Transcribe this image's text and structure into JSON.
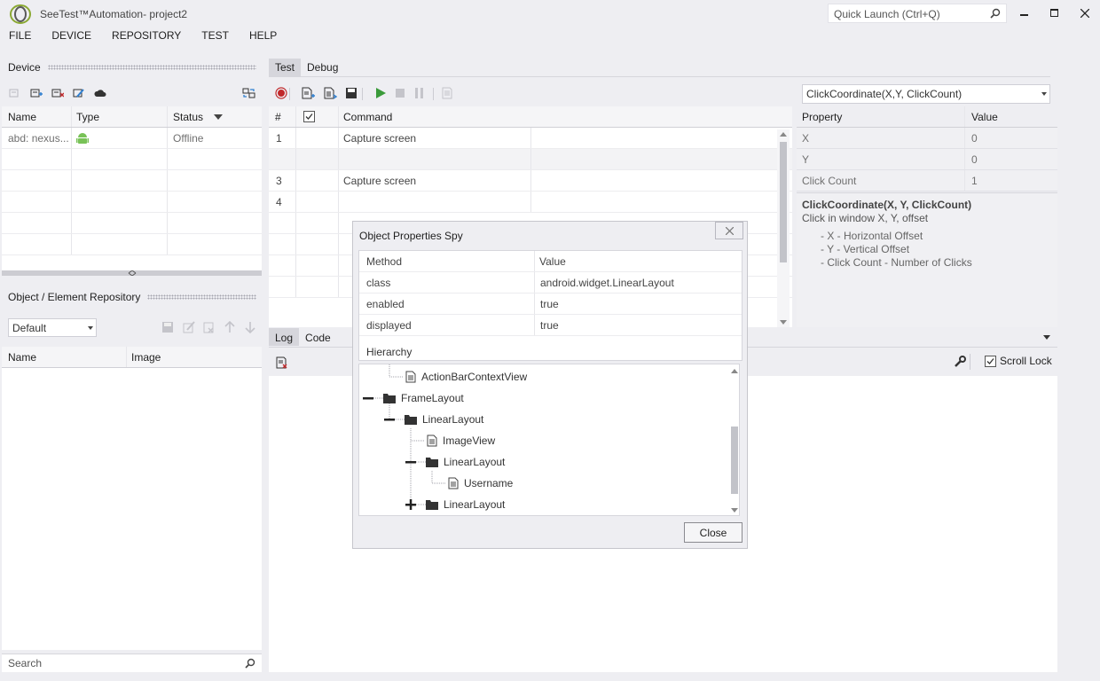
{
  "window": {
    "title": "SeeTest™Automation- project2",
    "quick_launch_placeholder": "Quick Launch (Ctrl+Q)"
  },
  "menu": [
    "FILE",
    "DEVICE",
    "REPOSITORY",
    "TEST",
    "HELP"
  ],
  "device_panel": {
    "title": "Device",
    "columns": [
      "Name",
      "Type",
      "Status"
    ],
    "rows": [
      {
        "name": "abd: nexus...",
        "type_icon": "android-icon",
        "status": "Offline"
      }
    ]
  },
  "repo_panel": {
    "title": "Object / Element Repository",
    "select_value": "Default",
    "columns": [
      "Name",
      "Image"
    ],
    "search_placeholder": "Search"
  },
  "test_panel": {
    "tabs": [
      "Test",
      "Debug"
    ],
    "active_tab": "Test",
    "columns": [
      "#",
      "",
      "Command"
    ],
    "rows": [
      {
        "num": "1",
        "command": "Capture screen"
      },
      {
        "num": "",
        "command": ""
      },
      {
        "num": "3",
        "command": "Capture screen"
      },
      {
        "num": "4",
        "command": ""
      }
    ]
  },
  "properties": {
    "command_select": "ClickCoordinate(X,Y, ClickCount)",
    "columns": [
      "Property",
      "Value"
    ],
    "rows": [
      {
        "property": "X",
        "value": "0"
      },
      {
        "property": "Y",
        "value": "0"
      },
      {
        "property": "Click Count",
        "value": "1"
      }
    ],
    "desc_title": "ClickCoordinate(X, Y, ClickCount)",
    "desc_summary": "Click in window X, Y, offset",
    "desc_params": [
      "- X - Horizontal Offset",
      "- Y - Vertical Offset",
      "- Click Count - Number of Clicks"
    ]
  },
  "log_panel": {
    "tabs": [
      "Log",
      "Code"
    ],
    "active_tab": "Log",
    "scroll_lock_label": "Scroll Lock",
    "scroll_lock_checked": true
  },
  "spy_dialog": {
    "title": "Object Properties Spy",
    "columns": [
      "Method",
      "Value"
    ],
    "rows": [
      {
        "method": "class",
        "value": "android.widget.LinearLayout"
      },
      {
        "method": "enabled",
        "value": "true"
      },
      {
        "method": "displayed",
        "value": "true"
      }
    ],
    "hierarchy_label": "Hierarchy",
    "tree": [
      {
        "label": "ActionBarContextView",
        "kind": "file"
      },
      {
        "label": "FrameLayout",
        "kind": "folder",
        "toggle": "collapse"
      },
      {
        "label": "LinearLayout",
        "kind": "folder",
        "toggle": "collapse"
      },
      {
        "label": "ImageView",
        "kind": "file"
      },
      {
        "label": "LinearLayout",
        "kind": "folder",
        "toggle": "collapse"
      },
      {
        "label": "Username",
        "kind": "file"
      },
      {
        "label": "LinearLayout",
        "kind": "folder",
        "toggle": "expand"
      }
    ],
    "close_label": "Close"
  },
  "colors": {
    "background": "#eeeef2",
    "accent_green": "#3a9a3a",
    "record_red": "#c0282a",
    "android_green": "#78c257"
  }
}
